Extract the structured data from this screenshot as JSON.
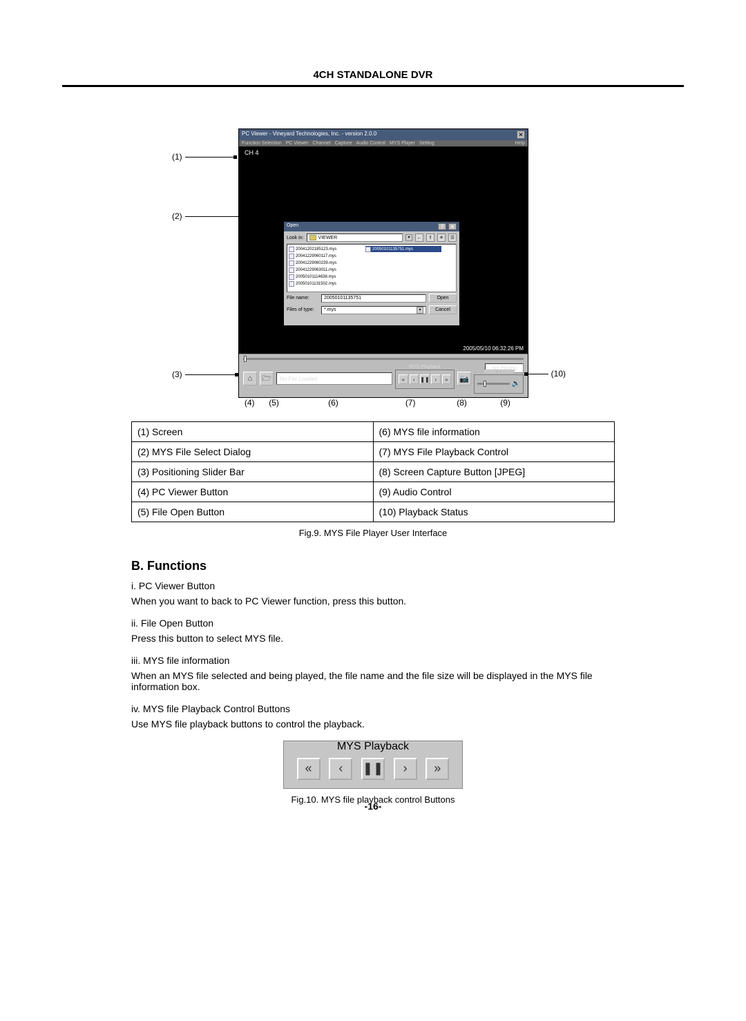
{
  "header": {
    "title": "4CH STANDALONE DVR"
  },
  "app": {
    "title": "PC Viewer - Vineyard Technologies, Inc. - version 2.0.0",
    "menu": [
      "Function Selection",
      "PC Viewer",
      "Channel",
      "Capture",
      "Audio Control",
      "MYS Player",
      "Setting"
    ],
    "menu_right": "Help",
    "ch_label": "CH 4",
    "timestamp": "2005/05/10 06:32:26 PM"
  },
  "dialog": {
    "title": "Open",
    "lookin_label": "Look in:",
    "lookin_val": "VIEWER",
    "files": [
      "20041202185123.mys",
      "20041229060117.mys",
      "20041229060239.mys",
      "20041229063011.mys",
      "20050101114638.mys",
      "20050101131502.mys"
    ],
    "file_selected": "20050101135751.mys",
    "fn_label": "File name:",
    "fn_val": "20050101135751",
    "type_label": "Files of type:",
    "type_val": "*.mys",
    "open_btn": "Open",
    "cancel_btn": "Cancel",
    "back_arrow": "←"
  },
  "ctrl": {
    "info": "No File Loaded",
    "pb_title": "MYS Playback",
    "status": "Not Playing",
    "audio_title": "Audio Control"
  },
  "callouts": {
    "c1": "(1)",
    "c2": "(2)",
    "c3": "(3)",
    "c4": "(4)",
    "c5": "(5)",
    "c6": "(6)",
    "c7": "(7)",
    "c8": "(8)",
    "c9": "(9)",
    "c10": "(10)"
  },
  "legend": {
    "r1a": "(1)  Screen",
    "r1b": "(6)  MYS file information",
    "r2a": "(2)  MYS File Select Dialog",
    "r2b": "(7)  MYS File Playback Control",
    "r3a": "(3)  Positioning Slider Bar",
    "r3b": "(8)  Screen Capture Button [JPEG]",
    "r4a": "(4)  PC Viewer Button",
    "r4b": "(9)  Audio Control",
    "r5a": "(5)  File Open Button",
    "r5b": "(10)  Playback Status"
  },
  "fig9": "Fig.9. MYS File Player User Interface",
  "functions": {
    "heading": "B. Functions",
    "i_t": "i. PC Viewer Button",
    "i_d": "When you want to back to PC Viewer function, press this button.",
    "ii_t": "ii. File Open Button",
    "ii_d": "Press this button to select MYS file.",
    "iii_t": "iii. MYS file information",
    "iii_d": "When an MYS file selected and being played, the file name and the file size will be displayed in the MYS file information box.",
    "iv_t": "iv. MYS file Playback Control Buttons",
    "iv_d": "Use MYS file playback buttons to control the playback."
  },
  "pb_fig": {
    "title": "MYS Playback"
  },
  "fig10": "Fig.10. MYS file playback control Buttons",
  "page_num": "-16-"
}
